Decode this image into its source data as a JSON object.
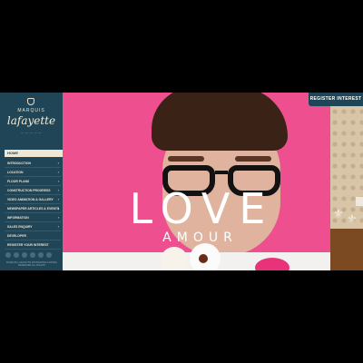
{
  "sidebar": {
    "logo": {
      "top_text": "MARQUIS",
      "script_text": "lafayette",
      "sub_text": "— — — — —"
    },
    "home_label": "HOME",
    "items": [
      {
        "label": "INTRODUCTION",
        "has_chevron": true
      },
      {
        "label": "LOCATION",
        "has_chevron": true
      },
      {
        "label": "FLOOR PLANS",
        "has_chevron": true
      },
      {
        "label": "CONSTRUCTION PROGRESS",
        "has_chevron": true
      },
      {
        "label": "VIDEO ANIMATION & GALLERY",
        "has_chevron": true
      },
      {
        "label": "NEWSPAPER ARTICLES & EVENTS",
        "has_chevron": true
      },
      {
        "label": "INFORMATION",
        "has_chevron": true
      },
      {
        "label": "SALES ENQUIRY",
        "has_chevron": true
      },
      {
        "label": "DEVELOPER",
        "has_chevron": false
      },
      {
        "label": "REGISTER YOUR INTEREST",
        "has_chevron": false
      }
    ],
    "chevron_icon": "›",
    "social_icons": [
      "social-icon",
      "social-icon",
      "social-icon",
      "social-icon",
      "social-icon",
      "social-icon"
    ],
    "footer_text": "MARQUIS LAFAYETTE PROPERTIES LIMITED. RESERVED ALL RIGHTS"
  },
  "header": {
    "register_label": "REGISTER INTEREST"
  },
  "hero": {
    "headline": "LOVE",
    "subheadline": "AMOUR"
  },
  "deco": {
    "fleur_glyph": "⚜"
  },
  "colors": {
    "sidebar_bg": "#1f4556",
    "hero_bg": "#ee4f8f",
    "home_highlight": "#efe7d3"
  }
}
